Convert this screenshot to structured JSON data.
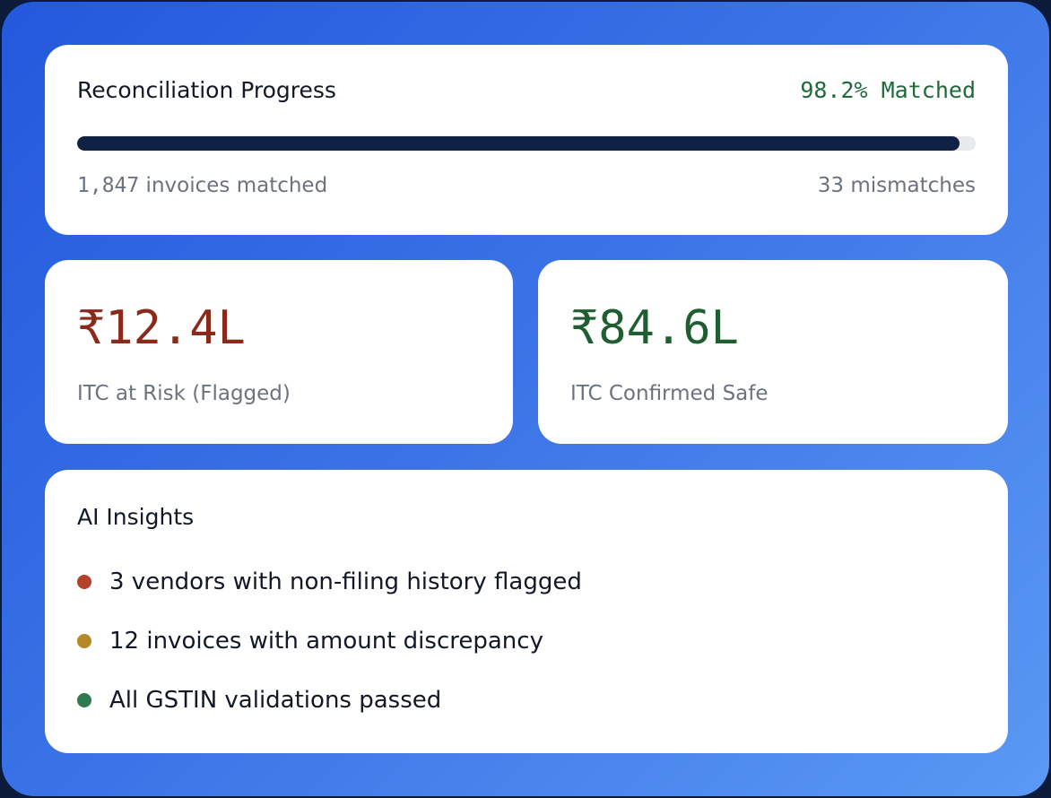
{
  "progress": {
    "title": "Reconciliation Progress",
    "matched_percent_label": "98.2% Matched",
    "fill_fraction": 0.982,
    "matched_count": "1,847",
    "matched_suffix": " invoices matched",
    "mismatches": "33 mismatches"
  },
  "stats": {
    "risk": {
      "value": "₹12.4L",
      "label": "ITC at Risk (Flagged)"
    },
    "safe": {
      "value": "₹84.6L",
      "label": "ITC Confirmed Safe"
    }
  },
  "insights": {
    "title": "AI Insights",
    "items": [
      {
        "text": "3 vendors with non-filing history flagged",
        "color": "#b5412d"
      },
      {
        "text": "12 invoices with amount discrepancy",
        "color": "#b58a26"
      },
      {
        "text": "All GSTIN validations passed",
        "color": "#2f7a4f"
      }
    ]
  },
  "colors": {
    "bar_fill": "#0f2145",
    "risk": "#8a2a1a",
    "safe": "#1e5e30",
    "matched": "#1f6a3a"
  }
}
